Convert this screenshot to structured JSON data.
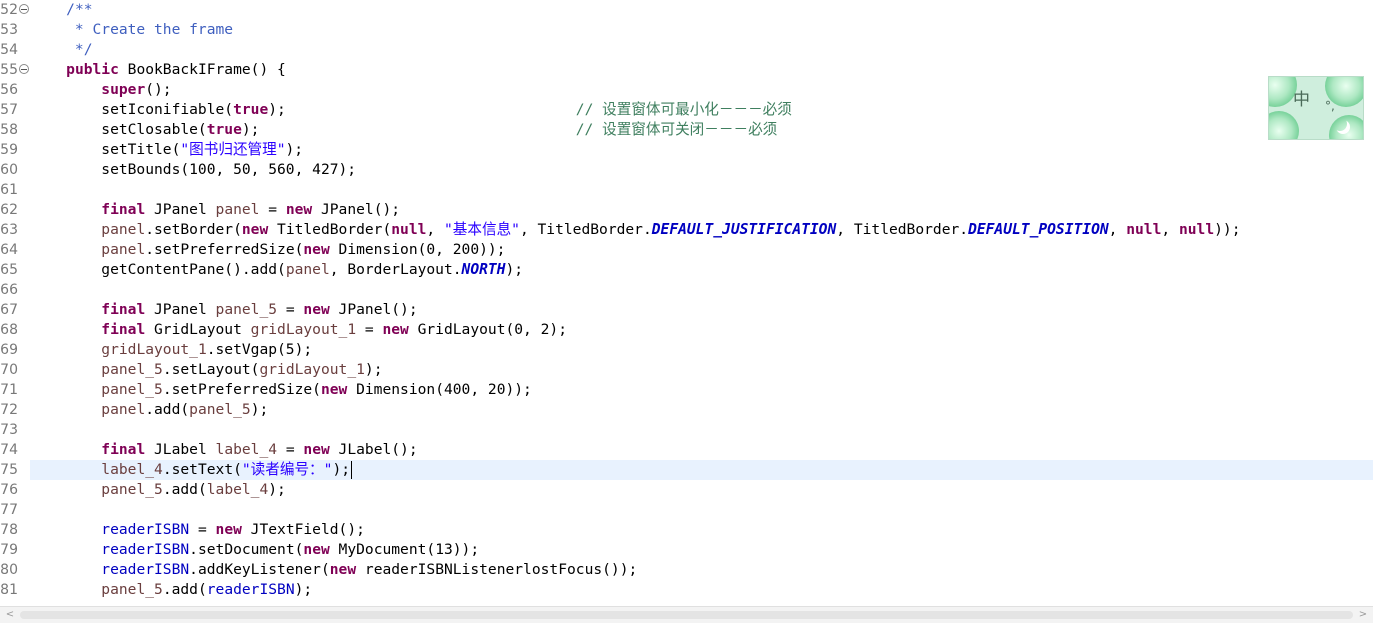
{
  "editor": {
    "lines": [
      {
        "n": "52",
        "fold": true,
        "tokens": [
          {
            "t": "    "
          },
          {
            "t": "/**",
            "c": "jd"
          }
        ]
      },
      {
        "n": "53",
        "tokens": [
          {
            "t": "     * Create the frame",
            "c": "jd"
          }
        ]
      },
      {
        "n": "54",
        "tokens": [
          {
            "t": "     */",
            "c": "jd"
          }
        ]
      },
      {
        "n": "55",
        "fold": true,
        "tokens": [
          {
            "t": "    "
          },
          {
            "t": "public",
            "c": "k"
          },
          {
            "t": " BookBackIFrame() {"
          }
        ]
      },
      {
        "n": "56",
        "tokens": [
          {
            "t": "        "
          },
          {
            "t": "super",
            "c": "k"
          },
          {
            "t": "();"
          }
        ]
      },
      {
        "n": "57",
        "tokens": [
          {
            "t": "        setIconifiable("
          },
          {
            "t": "true",
            "c": "k"
          },
          {
            "t": ");                                 "
          },
          {
            "t": "// 设置窗体可最小化－－－必须",
            "c": "c"
          }
        ]
      },
      {
        "n": "58",
        "tokens": [
          {
            "t": "        setClosable("
          },
          {
            "t": "true",
            "c": "k"
          },
          {
            "t": ");                                    "
          },
          {
            "t": "// 设置窗体可关闭－－－必须",
            "c": "c"
          }
        ]
      },
      {
        "n": "59",
        "tokens": [
          {
            "t": "        setTitle("
          },
          {
            "t": "\"图书归还管理\"",
            "c": "s"
          },
          {
            "t": ");"
          }
        ]
      },
      {
        "n": "60",
        "tokens": [
          {
            "t": "        setBounds(100, 50, 560, 427);"
          }
        ]
      },
      {
        "n": "61",
        "tokens": []
      },
      {
        "n": "62",
        "tokens": [
          {
            "t": "        "
          },
          {
            "t": "final",
            "c": "k"
          },
          {
            "t": " JPanel "
          },
          {
            "t": "panel",
            "c": "lv"
          },
          {
            "t": " = "
          },
          {
            "t": "new",
            "c": "k"
          },
          {
            "t": " JPanel();"
          }
        ]
      },
      {
        "n": "63",
        "tokens": [
          {
            "t": "        "
          },
          {
            "t": "panel",
            "c": "lv"
          },
          {
            "t": ".setBorder("
          },
          {
            "t": "new",
            "c": "k"
          },
          {
            "t": " TitledBorder("
          },
          {
            "t": "null",
            "c": "k"
          },
          {
            "t": ", "
          },
          {
            "t": "\"基本信息\"",
            "c": "s"
          },
          {
            "t": ", TitledBorder."
          },
          {
            "t": "DEFAULT_JUSTIFICATION",
            "c": "sf"
          },
          {
            "t": ", TitledBorder."
          },
          {
            "t": "DEFAULT_POSITION",
            "c": "sf"
          },
          {
            "t": ", "
          },
          {
            "t": "null",
            "c": "k"
          },
          {
            "t": ", "
          },
          {
            "t": "null",
            "c": "k"
          },
          {
            "t": "));"
          }
        ]
      },
      {
        "n": "64",
        "tokens": [
          {
            "t": "        "
          },
          {
            "t": "panel",
            "c": "lv"
          },
          {
            "t": ".setPreferredSize("
          },
          {
            "t": "new",
            "c": "k"
          },
          {
            "t": " Dimension(0, 200));"
          }
        ]
      },
      {
        "n": "65",
        "tokens": [
          {
            "t": "        getContentPane().add("
          },
          {
            "t": "panel",
            "c": "lv"
          },
          {
            "t": ", BorderLayout."
          },
          {
            "t": "NORTH",
            "c": "sf"
          },
          {
            "t": ");"
          }
        ]
      },
      {
        "n": "66",
        "tokens": []
      },
      {
        "n": "67",
        "tokens": [
          {
            "t": "        "
          },
          {
            "t": "final",
            "c": "k"
          },
          {
            "t": " JPanel "
          },
          {
            "t": "panel_5",
            "c": "lv"
          },
          {
            "t": " = "
          },
          {
            "t": "new",
            "c": "k"
          },
          {
            "t": " JPanel();"
          }
        ]
      },
      {
        "n": "68",
        "tokens": [
          {
            "t": "        "
          },
          {
            "t": "final",
            "c": "k"
          },
          {
            "t": " GridLayout "
          },
          {
            "t": "gridLayout_1",
            "c": "lv"
          },
          {
            "t": " = "
          },
          {
            "t": "new",
            "c": "k"
          },
          {
            "t": " GridLayout(0, 2);"
          }
        ]
      },
      {
        "n": "69",
        "tokens": [
          {
            "t": "        "
          },
          {
            "t": "gridLayout_1",
            "c": "lv"
          },
          {
            "t": ".setVgap(5);"
          }
        ]
      },
      {
        "n": "70",
        "tokens": [
          {
            "t": "        "
          },
          {
            "t": "panel_5",
            "c": "lv"
          },
          {
            "t": ".setLayout("
          },
          {
            "t": "gridLayout_1",
            "c": "lv"
          },
          {
            "t": ");"
          }
        ]
      },
      {
        "n": "71",
        "tokens": [
          {
            "t": "        "
          },
          {
            "t": "panel_5",
            "c": "lv"
          },
          {
            "t": ".setPreferredSize("
          },
          {
            "t": "new",
            "c": "k"
          },
          {
            "t": " Dimension(400, 20));"
          }
        ]
      },
      {
        "n": "72",
        "tokens": [
          {
            "t": "        "
          },
          {
            "t": "panel",
            "c": "lv"
          },
          {
            "t": ".add("
          },
          {
            "t": "panel_5",
            "c": "lv"
          },
          {
            "t": ");"
          }
        ]
      },
      {
        "n": "73",
        "tokens": []
      },
      {
        "n": "74",
        "tokens": [
          {
            "t": "        "
          },
          {
            "t": "final",
            "c": "k"
          },
          {
            "t": " JLabel "
          },
          {
            "t": "label_4",
            "c": "lv"
          },
          {
            "t": " = "
          },
          {
            "t": "new",
            "c": "k"
          },
          {
            "t": " JLabel();"
          }
        ]
      },
      {
        "n": "75",
        "current": true,
        "tokens": [
          {
            "t": "        "
          },
          {
            "t": "label_4",
            "c": "lv"
          },
          {
            "t": ".setText("
          },
          {
            "t": "\"读者编号：\"",
            "c": "s"
          },
          {
            "t": ");"
          }
        ]
      },
      {
        "n": "76",
        "tokens": [
          {
            "t": "        "
          },
          {
            "t": "panel_5",
            "c": "lv"
          },
          {
            "t": ".add("
          },
          {
            "t": "label_4",
            "c": "lv"
          },
          {
            "t": ");"
          }
        ]
      },
      {
        "n": "77",
        "tokens": []
      },
      {
        "n": "78",
        "tokens": [
          {
            "t": "        "
          },
          {
            "t": "readerISBN",
            "c": "f"
          },
          {
            "t": " = "
          },
          {
            "t": "new",
            "c": "k"
          },
          {
            "t": " JTextField();"
          }
        ]
      },
      {
        "n": "79",
        "tokens": [
          {
            "t": "        "
          },
          {
            "t": "readerISBN",
            "c": "f"
          },
          {
            "t": ".setDocument("
          },
          {
            "t": "new",
            "c": "k"
          },
          {
            "t": " MyDocument(13));"
          }
        ]
      },
      {
        "n": "80",
        "tokens": [
          {
            "t": "        "
          },
          {
            "t": "readerISBN",
            "c": "f"
          },
          {
            "t": ".addKeyListener("
          },
          {
            "t": "new",
            "c": "k"
          },
          {
            "t": " readerISBNListenerlostFocus());"
          }
        ]
      },
      {
        "n": "81",
        "tokens": [
          {
            "t": "        "
          },
          {
            "t": "panel_5",
            "c": "lv"
          },
          {
            "t": ".add("
          },
          {
            "t": "readerISBN",
            "c": "f"
          },
          {
            "t": ");"
          }
        ]
      }
    ]
  },
  "ime": {
    "char": "中",
    "dots": "°,"
  },
  "scroll": {
    "left_arrow": "<",
    "right_arrow": ">"
  },
  "icons": {
    "fold": "fold-collapse-icon",
    "left": "scroll-left-icon",
    "right": "scroll-right-icon"
  }
}
